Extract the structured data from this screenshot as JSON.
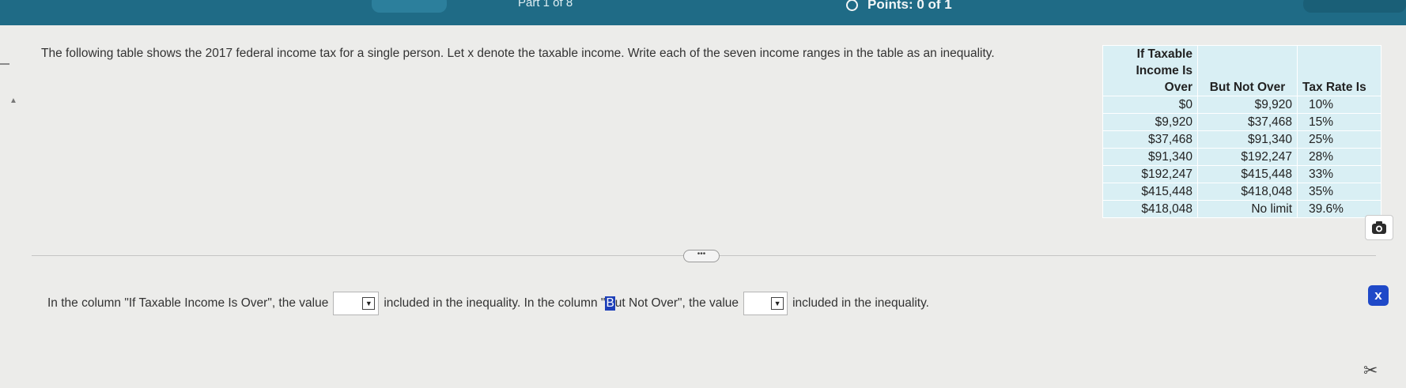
{
  "header": {
    "part_label": "Part 1 of 8",
    "points_label": "Points: 0 of 1"
  },
  "question": {
    "text": "The following table shows the 2017 federal income tax for a single person. Let x denote the taxable income. Write each of the seven income ranges in the table as an inequality."
  },
  "tax_table": {
    "headers": [
      "If Taxable Income Is Over",
      "But Not Over",
      "Tax Rate Is"
    ],
    "rows": [
      [
        "$0",
        "$9,920",
        "10%"
      ],
      [
        "$9,920",
        "$37,468",
        "15%"
      ],
      [
        "$37,468",
        "$91,340",
        "25%"
      ],
      [
        "$91,340",
        "$192,247",
        "28%"
      ],
      [
        "$192,247",
        "$415,448",
        "33%"
      ],
      [
        "$415,448",
        "$418,048",
        "35%"
      ],
      [
        "$418,048",
        "No limit",
        "39.6%"
      ]
    ]
  },
  "divider": {
    "more_label": "•••"
  },
  "answer": {
    "part1": "In the column \"If Taxable Income Is Over\", the value",
    "dropdown1_value": "",
    "part2": "included in the inequality. In the column \"",
    "cursor_char": "B",
    "part3": "ut Not Over\", the value",
    "dropdown2_value": "",
    "part4": "included in the inequality."
  },
  "icons": {
    "camera": "camera-icon",
    "close": "close-icon",
    "scissors": "scissors-icon",
    "points": "circle-icon",
    "caret": "dropdown-caret-icon"
  },
  "colors": {
    "header_bar": "#1f6b86",
    "table_fill": "#d9eff4",
    "accent": "#1f49c8"
  }
}
